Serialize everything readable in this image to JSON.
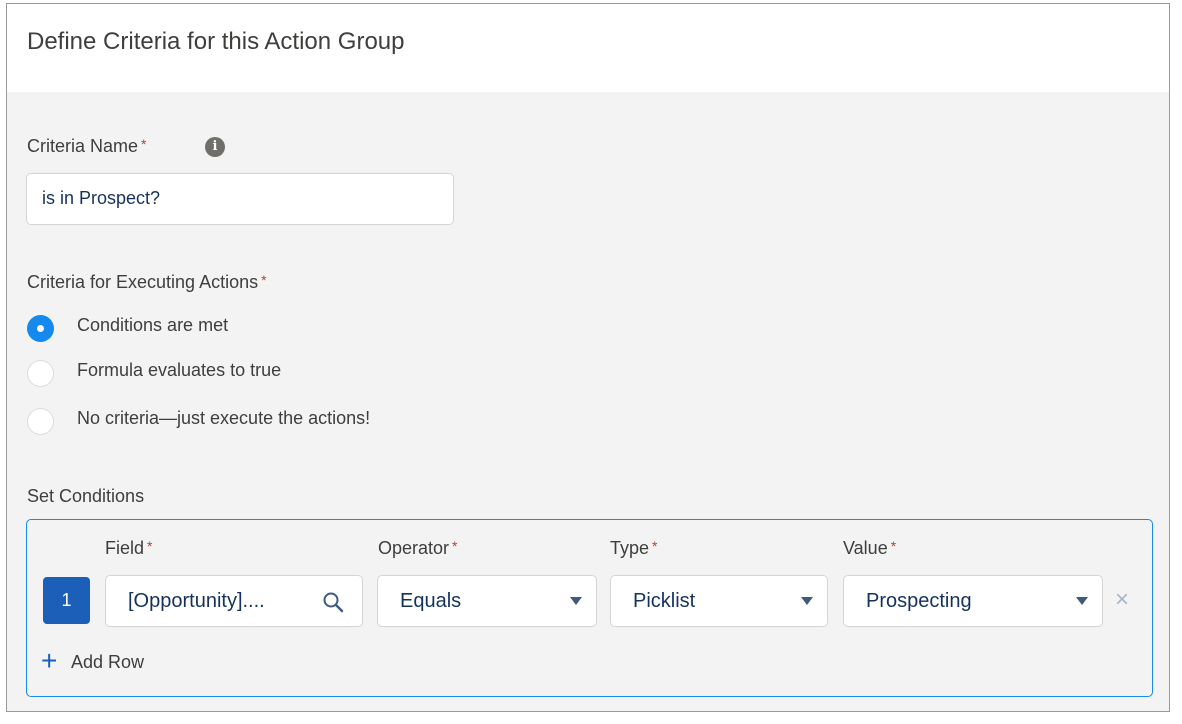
{
  "header": {
    "title": "Define Criteria for this Action Group"
  },
  "criteria_name": {
    "label": "Criteria Name",
    "required_mark": "*",
    "info_icon": "info-icon",
    "value": "is in Prospect?"
  },
  "executing": {
    "label": "Criteria for Executing Actions",
    "required_mark": "*",
    "options": [
      {
        "label": "Conditions are met",
        "checked": true
      },
      {
        "label": "Formula evaluates to true",
        "checked": false
      },
      {
        "label": "No criteria—just execute the actions!",
        "checked": false
      }
    ]
  },
  "conditions": {
    "label": "Set Conditions",
    "columns": [
      {
        "label": "Field",
        "required_mark": "*"
      },
      {
        "label": "Operator",
        "required_mark": "*"
      },
      {
        "label": "Type",
        "required_mark": "*"
      },
      {
        "label": "Value",
        "required_mark": "*"
      }
    ],
    "rows": [
      {
        "number": "1",
        "field": "[Opportunity]....",
        "operator": "Equals",
        "type": "Picklist",
        "value": "Prospecting"
      }
    ],
    "add_row_label": "Add Row",
    "icons": {
      "add": "plus-icon",
      "remove": "close-icon",
      "search": "search-icon",
      "dropdown": "chevron-down-icon"
    }
  },
  "colors": {
    "accent": "#1589ee",
    "row_badge": "#1b5fb8",
    "required": "#c23934",
    "text_value": "#16325c"
  }
}
